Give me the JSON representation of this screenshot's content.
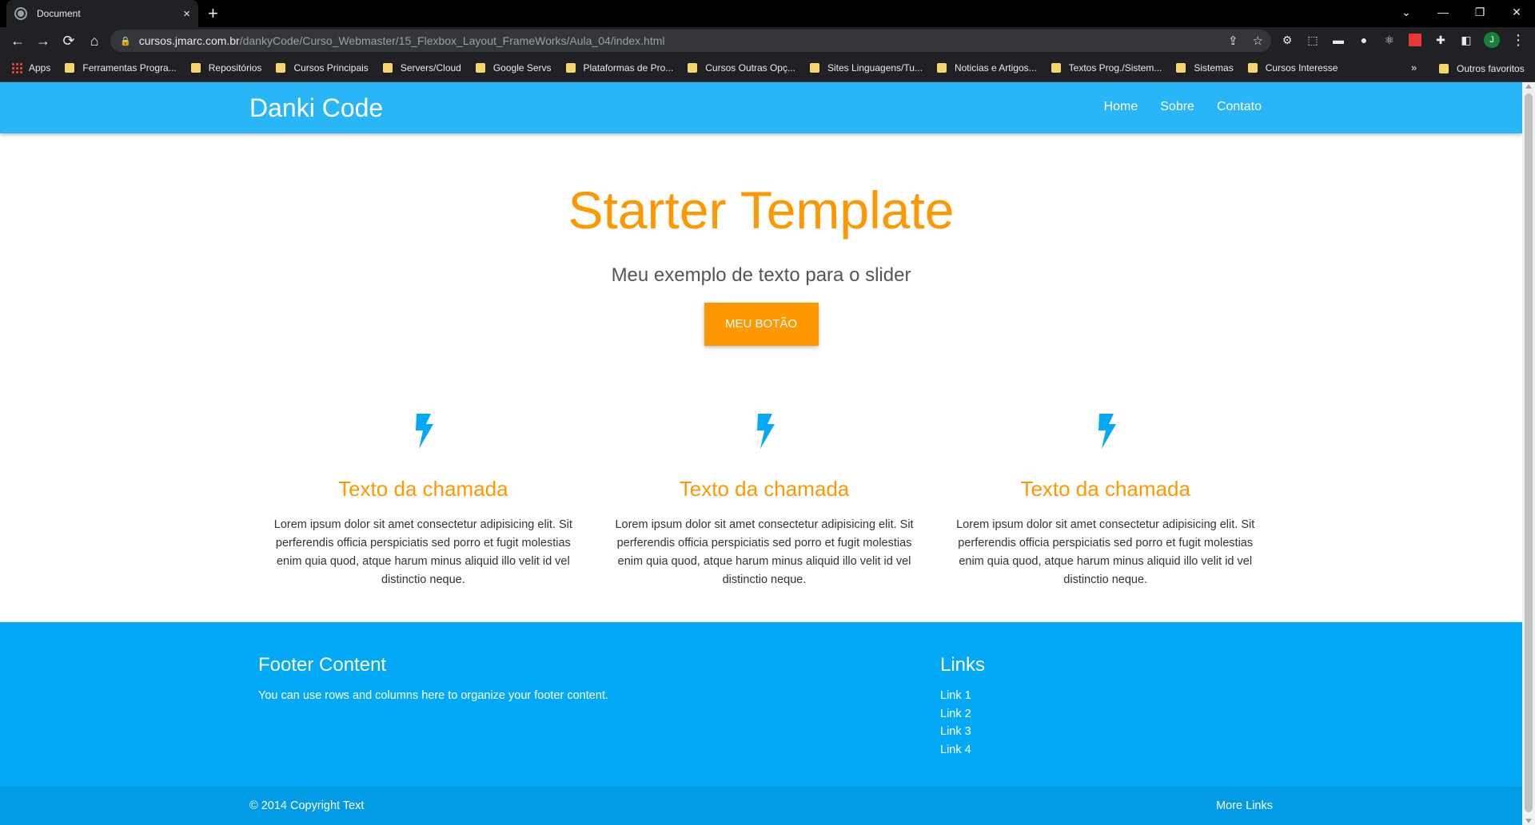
{
  "browser": {
    "tab_title": "Document",
    "tab_close": "×",
    "new_tab": "+",
    "url_host": "cursos.jmarc.com.br",
    "url_path": "/dankyCode/Curso_Webmaster/15_Flexbox_Layout_FrameWorks/Aula_04/index.html",
    "profile_initial": "J",
    "bookmarks": [
      "Apps",
      "Ferramentas Progra...",
      "Repositórios",
      "Cursos Principais",
      "Servers/Cloud",
      "Google Servs",
      "Plataformas de Pro...",
      "Cursos Outras Opç...",
      "Sites Linguagens/Tu...",
      "Noticias e Artigos...",
      "Textos Prog./Sistem...",
      "Sistemas",
      "Cursos Interesse"
    ],
    "bookmarks_more": "»",
    "other_bookmarks": "Outros favoritos"
  },
  "nav": {
    "brand": "Danki Code",
    "links": [
      "Home",
      "Sobre",
      "Contato"
    ]
  },
  "hero": {
    "title": "Starter Template",
    "subtitle": "Meu exemplo de texto para o slider",
    "button": "MEU BOTÃO"
  },
  "features": [
    {
      "title": "Texto da chamada",
      "text": "Lorem ipsum dolor sit amet consectetur adipisicing elit. Sit perferendis officia perspiciatis sed porro et fugit molestias enim quia quod, atque harum minus aliquid illo velit id vel distinctio neque."
    },
    {
      "title": "Texto da chamada",
      "text": "Lorem ipsum dolor sit amet consectetur adipisicing elit. Sit perferendis officia perspiciatis sed porro et fugit molestias enim quia quod, atque harum minus aliquid illo velit id vel distinctio neque."
    },
    {
      "title": "Texto da chamada",
      "text": "Lorem ipsum dolor sit amet consectetur adipisicing elit. Sit perferendis officia perspiciatis sed porro et fugit molestias enim quia quod, atque harum minus aliquid illo velit id vel distinctio neque."
    }
  ],
  "footer": {
    "content_title": "Footer Content",
    "content_text": "You can use rows and columns here to organize your footer content.",
    "links_title": "Links",
    "links": [
      "Link 1",
      "Link 2",
      "Link 3",
      "Link 4"
    ],
    "copyright": "© 2014 Copyright Text",
    "more_links": "More Links"
  },
  "colors": {
    "nav": "#29b6f6",
    "accent": "#ff9800",
    "bolt": "#03a9f4",
    "footer": "#03a9f4",
    "footer_bottom": "#039be5"
  },
  "icons": {
    "feature": "bolt-icon"
  }
}
